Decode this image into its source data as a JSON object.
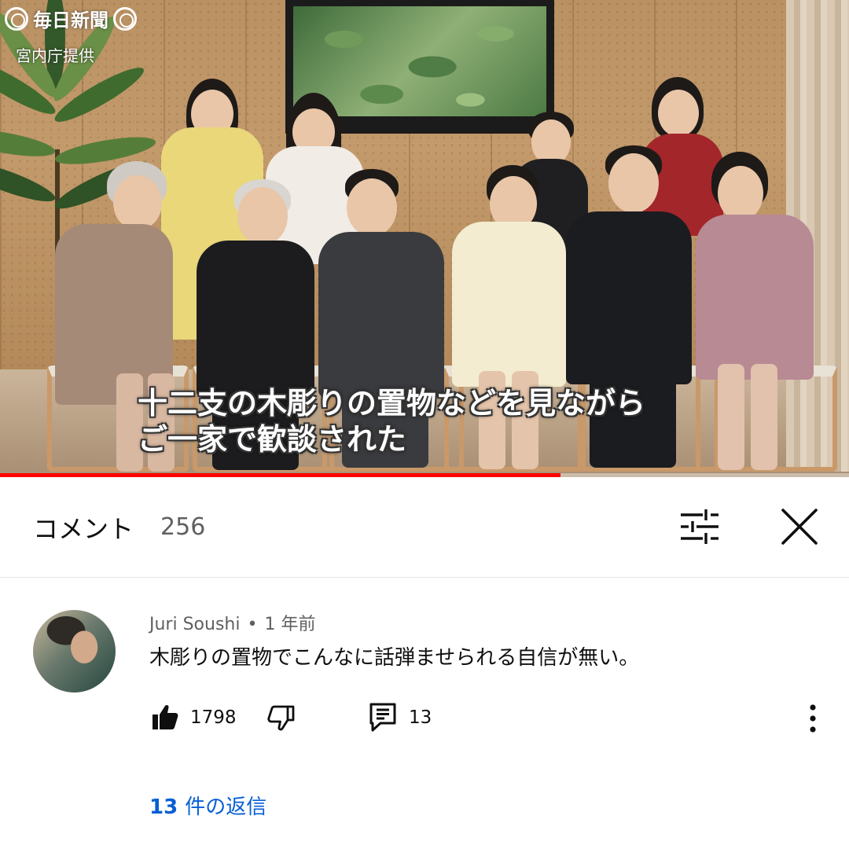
{
  "video": {
    "watermark": "毎日新聞",
    "credit": "宮内庁提供",
    "subtitle_line1": "十二支の木彫りの置物などを見ながら",
    "subtitle_line2": "ご一家で歓談された",
    "progress_fraction": 0.66,
    "progress_color": "#ff0000"
  },
  "comments_header": {
    "title": "コメント",
    "count": "256",
    "filter_icon": "sort-filter-icon",
    "close_icon": "close-icon"
  },
  "comment": {
    "author": "Juri Soushi",
    "separator": "•",
    "time": "1 年前",
    "text": "木彫りの置物でこんなに話弾ませられる自信が無い。",
    "likes": "1798",
    "replies_count": "13",
    "replies_link_count": "13",
    "replies_link_label": "件の返信",
    "link_color": "#065fd4"
  }
}
